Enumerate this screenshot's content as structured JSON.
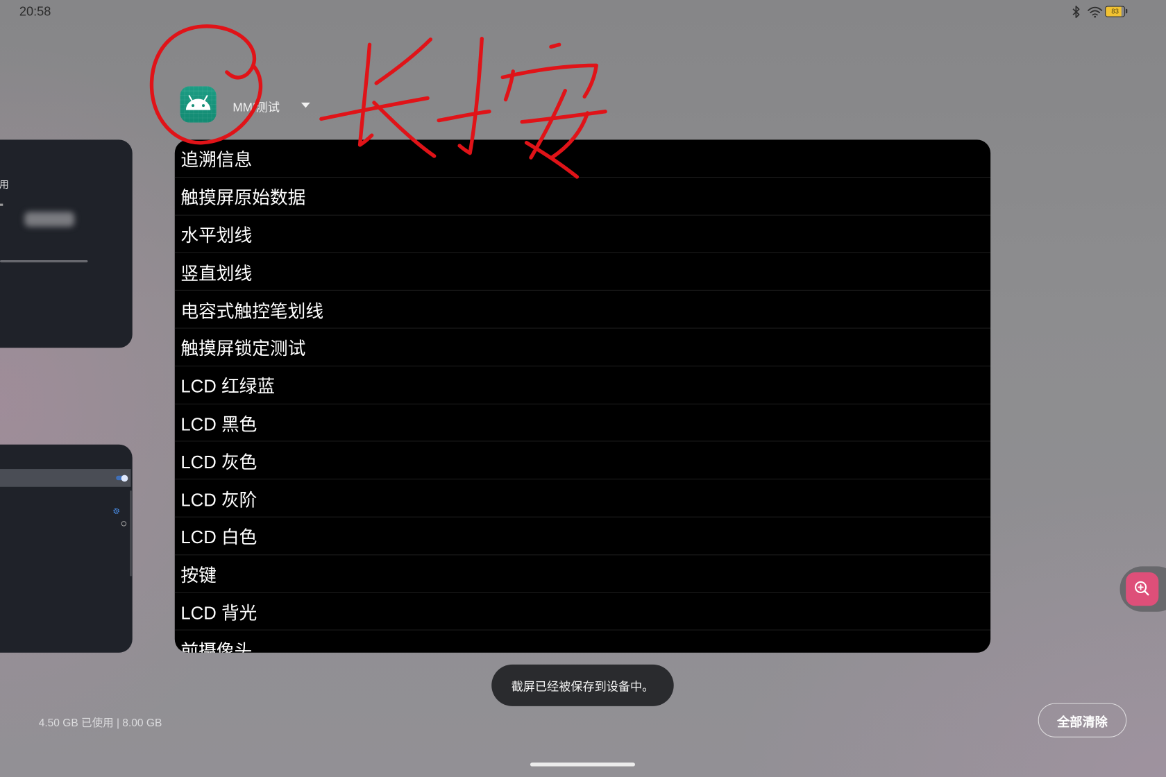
{
  "status_bar": {
    "time": "20:58",
    "battery_level": "83",
    "icons": [
      "bluetooth-icon",
      "wifi-icon",
      "battery-icon"
    ]
  },
  "app": {
    "title": "MMI测试",
    "icon": "android-icon"
  },
  "annotation": {
    "text": "长按",
    "color": "#e01318"
  },
  "menu": {
    "items": [
      "追溯信息",
      "触摸屏原始数据",
      "水平划线",
      "竖直划线",
      "电容式触控笔划线",
      "触摸屏锁定测试",
      "LCD 红绿蓝",
      "LCD 黑色",
      "LCD 灰色",
      "LCD 灰阶",
      "LCD 白色",
      "按键",
      "LCD 背光",
      "前摄像头"
    ]
  },
  "recent_cards": {
    "card1_label": "用"
  },
  "toast": {
    "text": "截屏已经被保存到设备中。"
  },
  "memory": {
    "text": "4.50 GB 已使用 | 8.00 GB"
  },
  "clear_all": {
    "label": "全部清除"
  },
  "floating_button": {
    "icon": "zoom-in-icon"
  },
  "colors": {
    "accent": "#de4f79",
    "annotation": "#e01318",
    "battery": "#f2c232",
    "app_icon": "#1c9d84"
  }
}
